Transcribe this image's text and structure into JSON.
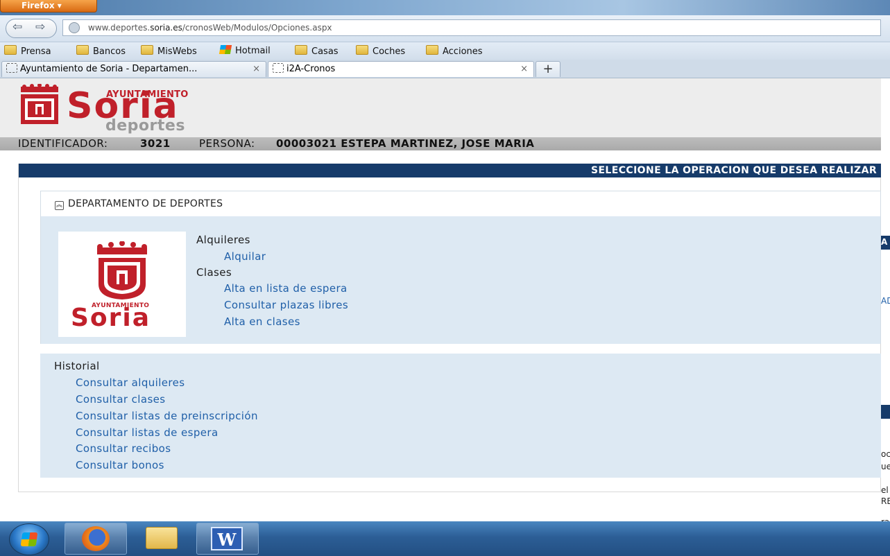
{
  "browser": {
    "app_button": "Firefox",
    "url_host_pre": "www.deportes.",
    "url_host_strong": "soria.es",
    "url_path": "/cronosWeb/Modulos/Opciones.aspx",
    "bookmarks": [
      "Prensa",
      "Bancos",
      "MisWebs",
      "Hotmail",
      "Casas",
      "Coches",
      "Acciones"
    ],
    "tabs": [
      {
        "label": "Ayuntamiento de Soria - Departamen...",
        "active": false
      },
      {
        "label": "i2A-Cronos",
        "active": true
      }
    ],
    "tab_close": "×",
    "new_tab": "+"
  },
  "header": {
    "logo_top": "AYUNTAMIENTO",
    "logo_main": "Soria",
    "logo_sub": "deportes"
  },
  "idbar": {
    "id_label": "IDENTIFICADOR:",
    "id_value": "3021",
    "person_label": "PERSONA:",
    "person_value": "00003021 ESTEPA MARTINEZ, JOSE MARIA"
  },
  "content": {
    "select_banner": "SELECCIONE LA OPERACION QUE DESEA REALIZAR",
    "department_title": "DEPARTAMENTO DE DEPORTES",
    "logo_box_top": "AYUNTAMIENTO",
    "logo_box_main": "Soria",
    "groups": [
      {
        "heading": "Alquileres",
        "links": [
          "Alquilar"
        ]
      },
      {
        "heading": "Clases",
        "links": [
          "Alta en lista de espera",
          "Consultar plazas libres",
          "Alta en clases"
        ]
      }
    ],
    "history": {
      "heading": "Historial",
      "links": [
        "Consultar alquileres",
        "Consultar clases",
        "Consultar listas de preinscripción",
        "Consultar listas de espera",
        "Consultar recibos",
        "Consultar bonos"
      ]
    }
  },
  "edge_fragments": [
    "A",
    "AD",
    "oc",
    "ue",
    "el",
    "RE",
    "ra"
  ],
  "colors": {
    "banner_navy": "#163b6a",
    "link_blue": "#1f5fa8",
    "panel_blue": "#dde9f3",
    "soria_red": "#c0202a"
  },
  "icons": [
    "back-arrow-icon",
    "forward-arrow-icon",
    "globe-icon",
    "folder-icon",
    "windows-flag-icon",
    "blank-page-icon",
    "collapse-up-icon",
    "firefox-icon",
    "explorer-icon",
    "word-icon"
  ]
}
